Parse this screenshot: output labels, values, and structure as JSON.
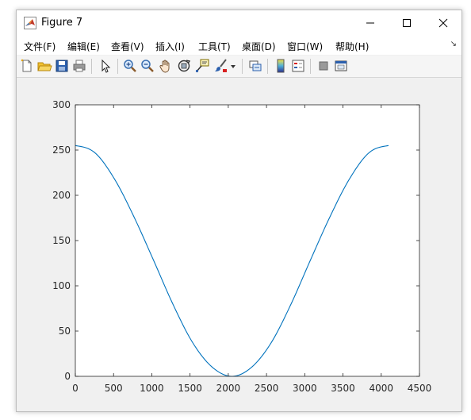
{
  "window": {
    "title": "Figure 7",
    "icon": "matlab-logo-icon",
    "controls": [
      "minimize-icon",
      "maximize-icon",
      "close-icon"
    ]
  },
  "menubar": {
    "items": [
      "文件(F)",
      "编辑(E)",
      "查看(V)",
      "插入(I)",
      "工具(T)",
      "桌面(D)",
      "窗口(W)",
      "帮助(H)"
    ],
    "overflow_icon": "dock-arrow-icon"
  },
  "toolbar": {
    "buttons": [
      "new-figure-icon",
      "open-folder-icon",
      "save-icon",
      "print-icon",
      "select-arrow-icon",
      "zoom-in-icon",
      "zoom-out-icon",
      "pan-hand-icon",
      "rotate-3d-icon",
      "data-cursor-icon",
      "brush-icon",
      "brush-dropdown-icon",
      "link-plot-icon",
      "colorbar-icon",
      "legend-icon",
      "hide-plot-tools-icon",
      "show-plot-tools-icon"
    ]
  },
  "chart_data": {
    "type": "line",
    "xlim": [
      0,
      4500
    ],
    "ylim": [
      0,
      300
    ],
    "xticks": [
      0,
      500,
      1000,
      1500,
      2000,
      2500,
      3000,
      3500,
      4000,
      4500
    ],
    "yticks": [
      0,
      50,
      100,
      150,
      200,
      250,
      300
    ],
    "grid": false,
    "line_color": "#0072bd",
    "series": [
      {
        "x": [
          0,
          256,
          512,
          768,
          1024,
          1280,
          1536,
          1792,
          2048,
          2304,
          2560,
          2816,
          3072,
          3328,
          3584,
          3840,
          4095
        ],
        "values": [
          255,
          247,
          218,
          176,
          128,
          79,
          37,
          10,
          0,
          10,
          37,
          79,
          128,
          176,
          218,
          247,
          255
        ]
      }
    ]
  }
}
